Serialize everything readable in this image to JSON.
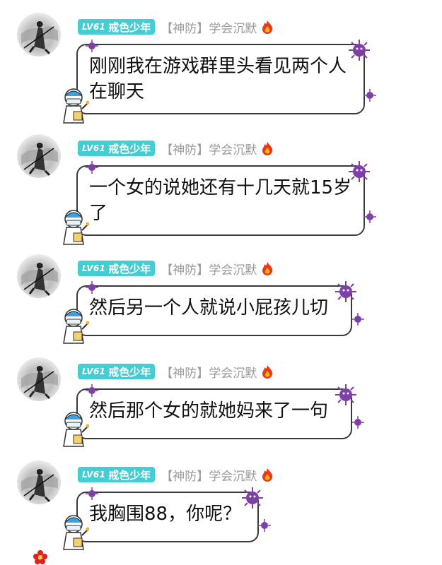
{
  "sender": {
    "level": "LV61",
    "name": "戒色少年",
    "title": "【神防】学会沉默"
  },
  "icons": {
    "avatar": "ink-painting-figure-avatar",
    "fire": "fire-icon",
    "bubble_decor_virus": "purple-virus-icon",
    "bubble_decor_mascot": "doctor-mascot-icon",
    "flower": "red-flower-icon"
  },
  "colors": {
    "level_badge": "#45cdd3",
    "title_text": "#9a9a9a",
    "bubble_border": "#3a3a3a",
    "virus": "#7e3fa6"
  },
  "messages": [
    {
      "text": "刚刚我在游戏群里头看见两个人在聊天"
    },
    {
      "text": "一个女的说她还有十几天就15岁了"
    },
    {
      "text": "然后另一个人就说小屁孩儿切"
    },
    {
      "text": "然后那个女的就她妈来了一句"
    },
    {
      "text": "我胸围88，你呢？"
    }
  ]
}
